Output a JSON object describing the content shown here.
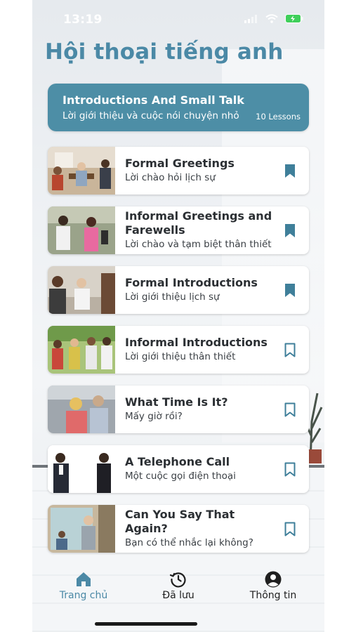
{
  "status_bar": {
    "time": "13:19"
  },
  "page_title": "Hội thoại tiếng anh",
  "hero": {
    "title": "Introductions And Small Talk",
    "subtitle": "Lời giới thiệu và cuộc nói chuyện nhỏ",
    "count": "10 Lessons",
    "color": "#4d8ea6"
  },
  "lessons": [
    {
      "title": "Formal Greetings",
      "subtitle": "Lời chào hỏi lịch sự",
      "bookmarked": true,
      "icon": "bookmark-filled-icon"
    },
    {
      "title": "Informal Greetings and Farewells",
      "subtitle": "Lời chào và tạm biệt thân thiết",
      "bookmarked": true,
      "icon": "bookmark-filled-icon"
    },
    {
      "title": "Formal Introductions",
      "subtitle": "Lời giới thiệu lịch sự",
      "bookmarked": true,
      "icon": "bookmark-filled-icon"
    },
    {
      "title": "Informal Introductions",
      "subtitle": "Lời giới thiệu thân thiết",
      "bookmarked": false,
      "icon": "bookmark-outline-icon"
    },
    {
      "title": "What Time Is It?",
      "subtitle": "Mấy giờ rồi?",
      "bookmarked": false,
      "icon": "bookmark-outline-icon"
    },
    {
      "title": "A Telephone Call",
      "subtitle": "Một cuộc gọi điện thoại",
      "bookmarked": false,
      "icon": "bookmark-outline-icon"
    },
    {
      "title": "Can You Say That Again?",
      "subtitle": "Bạn có thể nhắc lại không?",
      "bookmarked": false,
      "icon": "bookmark-outline-icon"
    }
  ],
  "tabbar": {
    "tabs": [
      {
        "label": "Trang chủ",
        "icon": "home-icon",
        "active": true
      },
      {
        "label": "Đã lưu",
        "icon": "history-icon",
        "active": false
      },
      {
        "label": "Thông tin",
        "icon": "user-circle-icon",
        "active": false
      }
    ],
    "active_color": "#4b89a6",
    "inactive_color": "#1f1f1f"
  },
  "colors": {
    "accent": "#4b89a6",
    "bookmark": "#3f7f9a"
  }
}
